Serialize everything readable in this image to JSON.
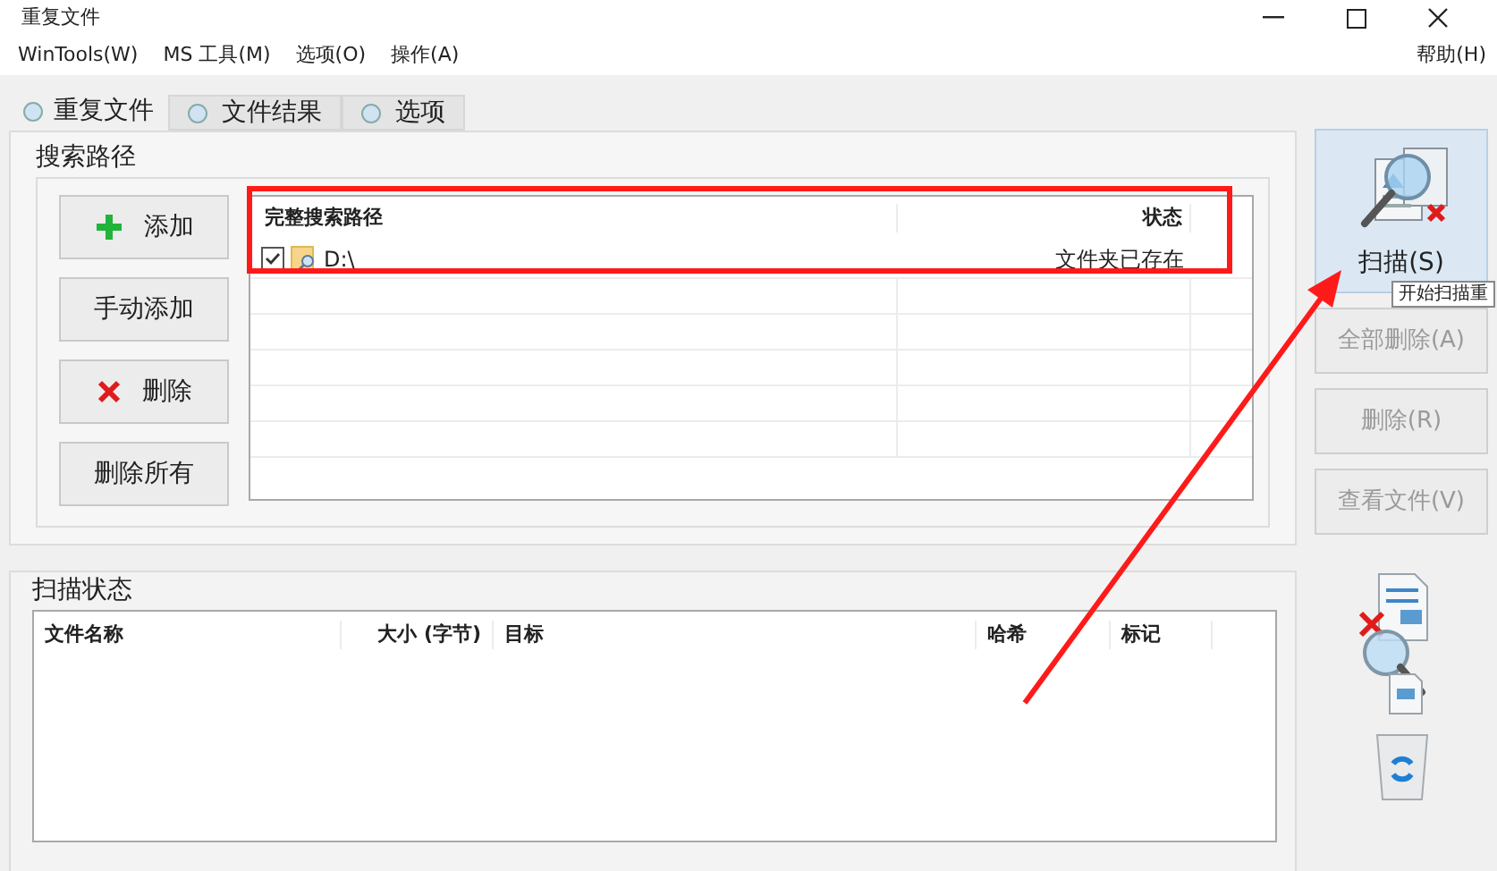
{
  "window": {
    "title": "重复文件"
  },
  "menu": [
    {
      "label": "WinTools(W)"
    },
    {
      "label": "MS 工具(M)"
    },
    {
      "label": "选项(O)"
    },
    {
      "label": "操作(A)"
    }
  ],
  "help_menu": {
    "label": "帮助(H)"
  },
  "tabs": [
    {
      "label": "重复文件",
      "selected": true
    },
    {
      "label": "文件结果",
      "selected": false
    },
    {
      "label": "选项",
      "selected": false
    }
  ],
  "search_paths": {
    "title": "搜索路径",
    "buttons": [
      {
        "label": "添加",
        "kind": "add"
      },
      {
        "label": "手动添加",
        "kind": "plain"
      },
      {
        "label": "删除",
        "kind": "remove"
      },
      {
        "label": "删除所有",
        "kind": "plain"
      }
    ],
    "columns": [
      "完整搜索路径",
      "状态"
    ],
    "rows": [
      {
        "path": "D:\\",
        "status": "文件夹已存在",
        "checked": true
      }
    ]
  },
  "scan_status": {
    "title": "扫描状态",
    "columns": [
      "文件名称",
      "大小 (字节)",
      "目标",
      "哈希",
      "标记"
    ]
  },
  "actions": [
    {
      "label": "扫描(S)",
      "kind": "scan",
      "disabled": false
    },
    {
      "label": "全部删除(A)",
      "kind": "plain",
      "disabled": true
    },
    {
      "label": "删除(R)",
      "kind": "plain",
      "disabled": true
    },
    {
      "label": "查看文件(V)",
      "kind": "plain",
      "disabled": true
    }
  ],
  "tooltip": {
    "text": "开始扫描重"
  }
}
